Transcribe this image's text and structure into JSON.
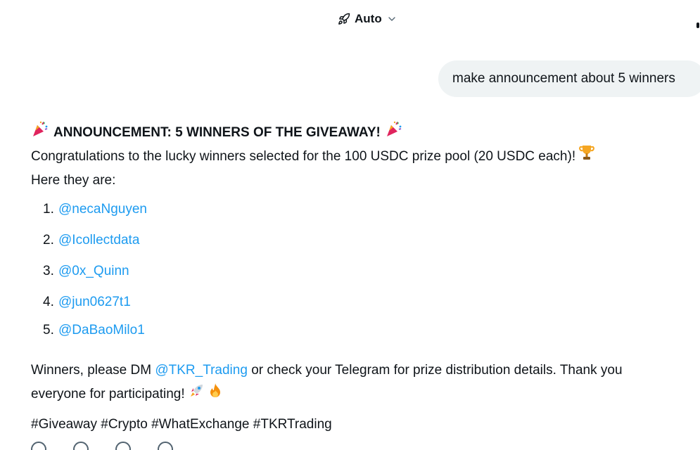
{
  "header": {
    "model_label": "Auto",
    "model_icon": "rocket-icon",
    "dropdown_icon": "chevron-down-icon"
  },
  "user_message": {
    "text": "make announcement about 5 winners"
  },
  "response": {
    "title": "ANNOUNCEMENT: 5 WINNERS OF THE GIVEAWAY!",
    "title_emoji": "party-popper-icon",
    "congrats": "Congratulations to the lucky winners selected for the 100 USDC prize pool (20 USDC each)!",
    "congrats_emoji": "trophy-icon",
    "intro": "Here they are:",
    "winners": [
      {
        "num": "1.",
        "handle": "@necaNguyen"
      },
      {
        "num": "2.",
        "handle": "@Icollectdata"
      },
      {
        "num": "3.",
        "handle": "@0x_Quinn"
      },
      {
        "num": "4.",
        "handle": "@jun0627t1"
      },
      {
        "num": "5.",
        "handle": "@DaBaoMilo1"
      }
    ],
    "closing_prefix": "Winners, please DM ",
    "closing_link": "@TKR_Trading",
    "closing_mid": " or check your Telegram for prize distribution details. Thank you",
    "closing_end": "everyone for participating!",
    "closing_emojis": [
      "rocket-icon",
      "fire-icon"
    ],
    "hashtags": "#Giveaway #Crypto #WhatExchange #TKRTrading"
  },
  "colors": {
    "link": "#1d9bf0",
    "bubble": "#eff3f4",
    "text": "#0f1419"
  }
}
